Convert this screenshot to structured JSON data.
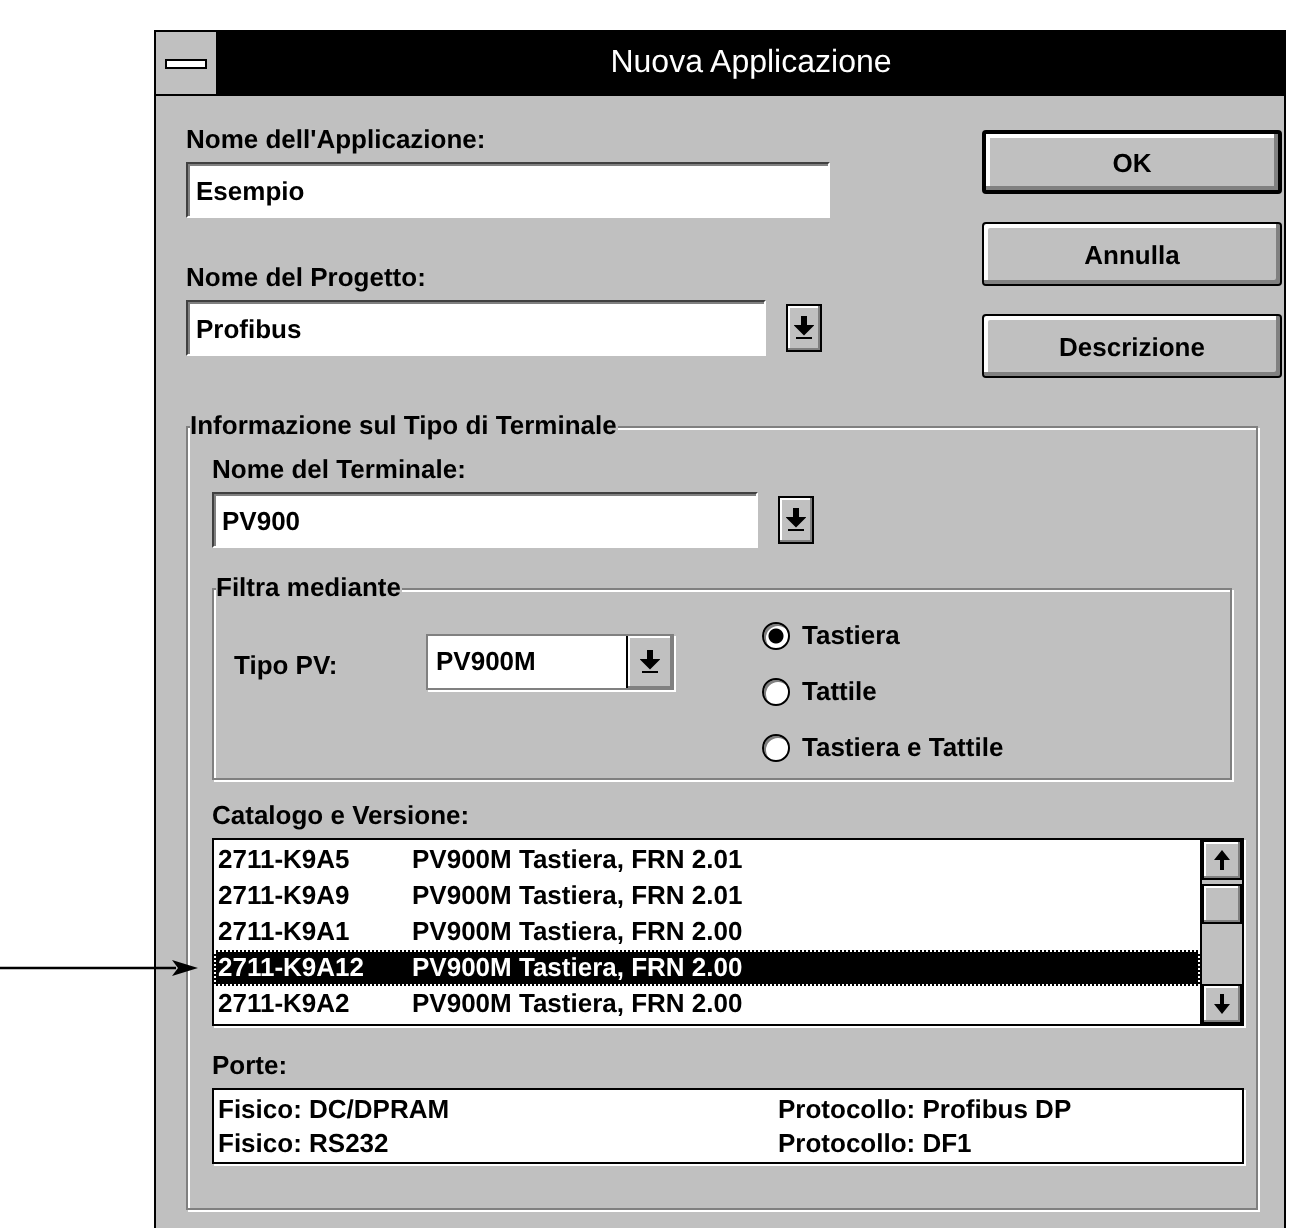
{
  "window": {
    "title": "Nuova Applicazione"
  },
  "application_name": {
    "label": "Nome dell'Applicazione:",
    "value": "Esempio"
  },
  "project_name": {
    "label": "Nome del Progetto:",
    "value": "Profibus"
  },
  "buttons": [
    {
      "label": "OK",
      "default": true
    },
    {
      "label": "Annulla",
      "default": false
    },
    {
      "label": "Descrizione",
      "default": false
    }
  ],
  "terminal_info": {
    "title": "Informazione sul Tipo di Terminale",
    "terminal_name": {
      "label": "Nome del Terminale:",
      "value": "PV900"
    },
    "filter": {
      "title": "Filtra mediante",
      "pv_type": {
        "label": "Tipo PV:",
        "value": "PV900M"
      },
      "options": [
        {
          "label": "Tastiera",
          "selected": true
        },
        {
          "label": "Tattile",
          "selected": false
        },
        {
          "label": "Tastiera e Tattile",
          "selected": false
        }
      ]
    },
    "catalog": {
      "label": "Catalogo e Versione:",
      "rows": [
        {
          "code": "2711-K9A5",
          "description": "PV900M Tastiera, FRN 2.01",
          "selected": false
        },
        {
          "code": "2711-K9A9",
          "description": "PV900M Tastiera, FRN 2.01",
          "selected": false
        },
        {
          "code": "2711-K9A1",
          "description": "PV900M Tastiera, FRN 2.00",
          "selected": false
        },
        {
          "code": "2711-K9A12",
          "description": "PV900M Tastiera, FRN 2.00",
          "selected": true
        },
        {
          "code": "2711-K9A2",
          "description": "PV900M Tastiera, FRN 2.00",
          "selected": false
        }
      ]
    },
    "ports": {
      "label": "Porte:",
      "rows": [
        {
          "physical": "Fisico: DC/DPRAM",
          "protocol": "Protocollo: Profibus DP"
        },
        {
          "physical": "Fisico: RS232",
          "protocol": "Protocollo: DF1"
        }
      ]
    }
  }
}
